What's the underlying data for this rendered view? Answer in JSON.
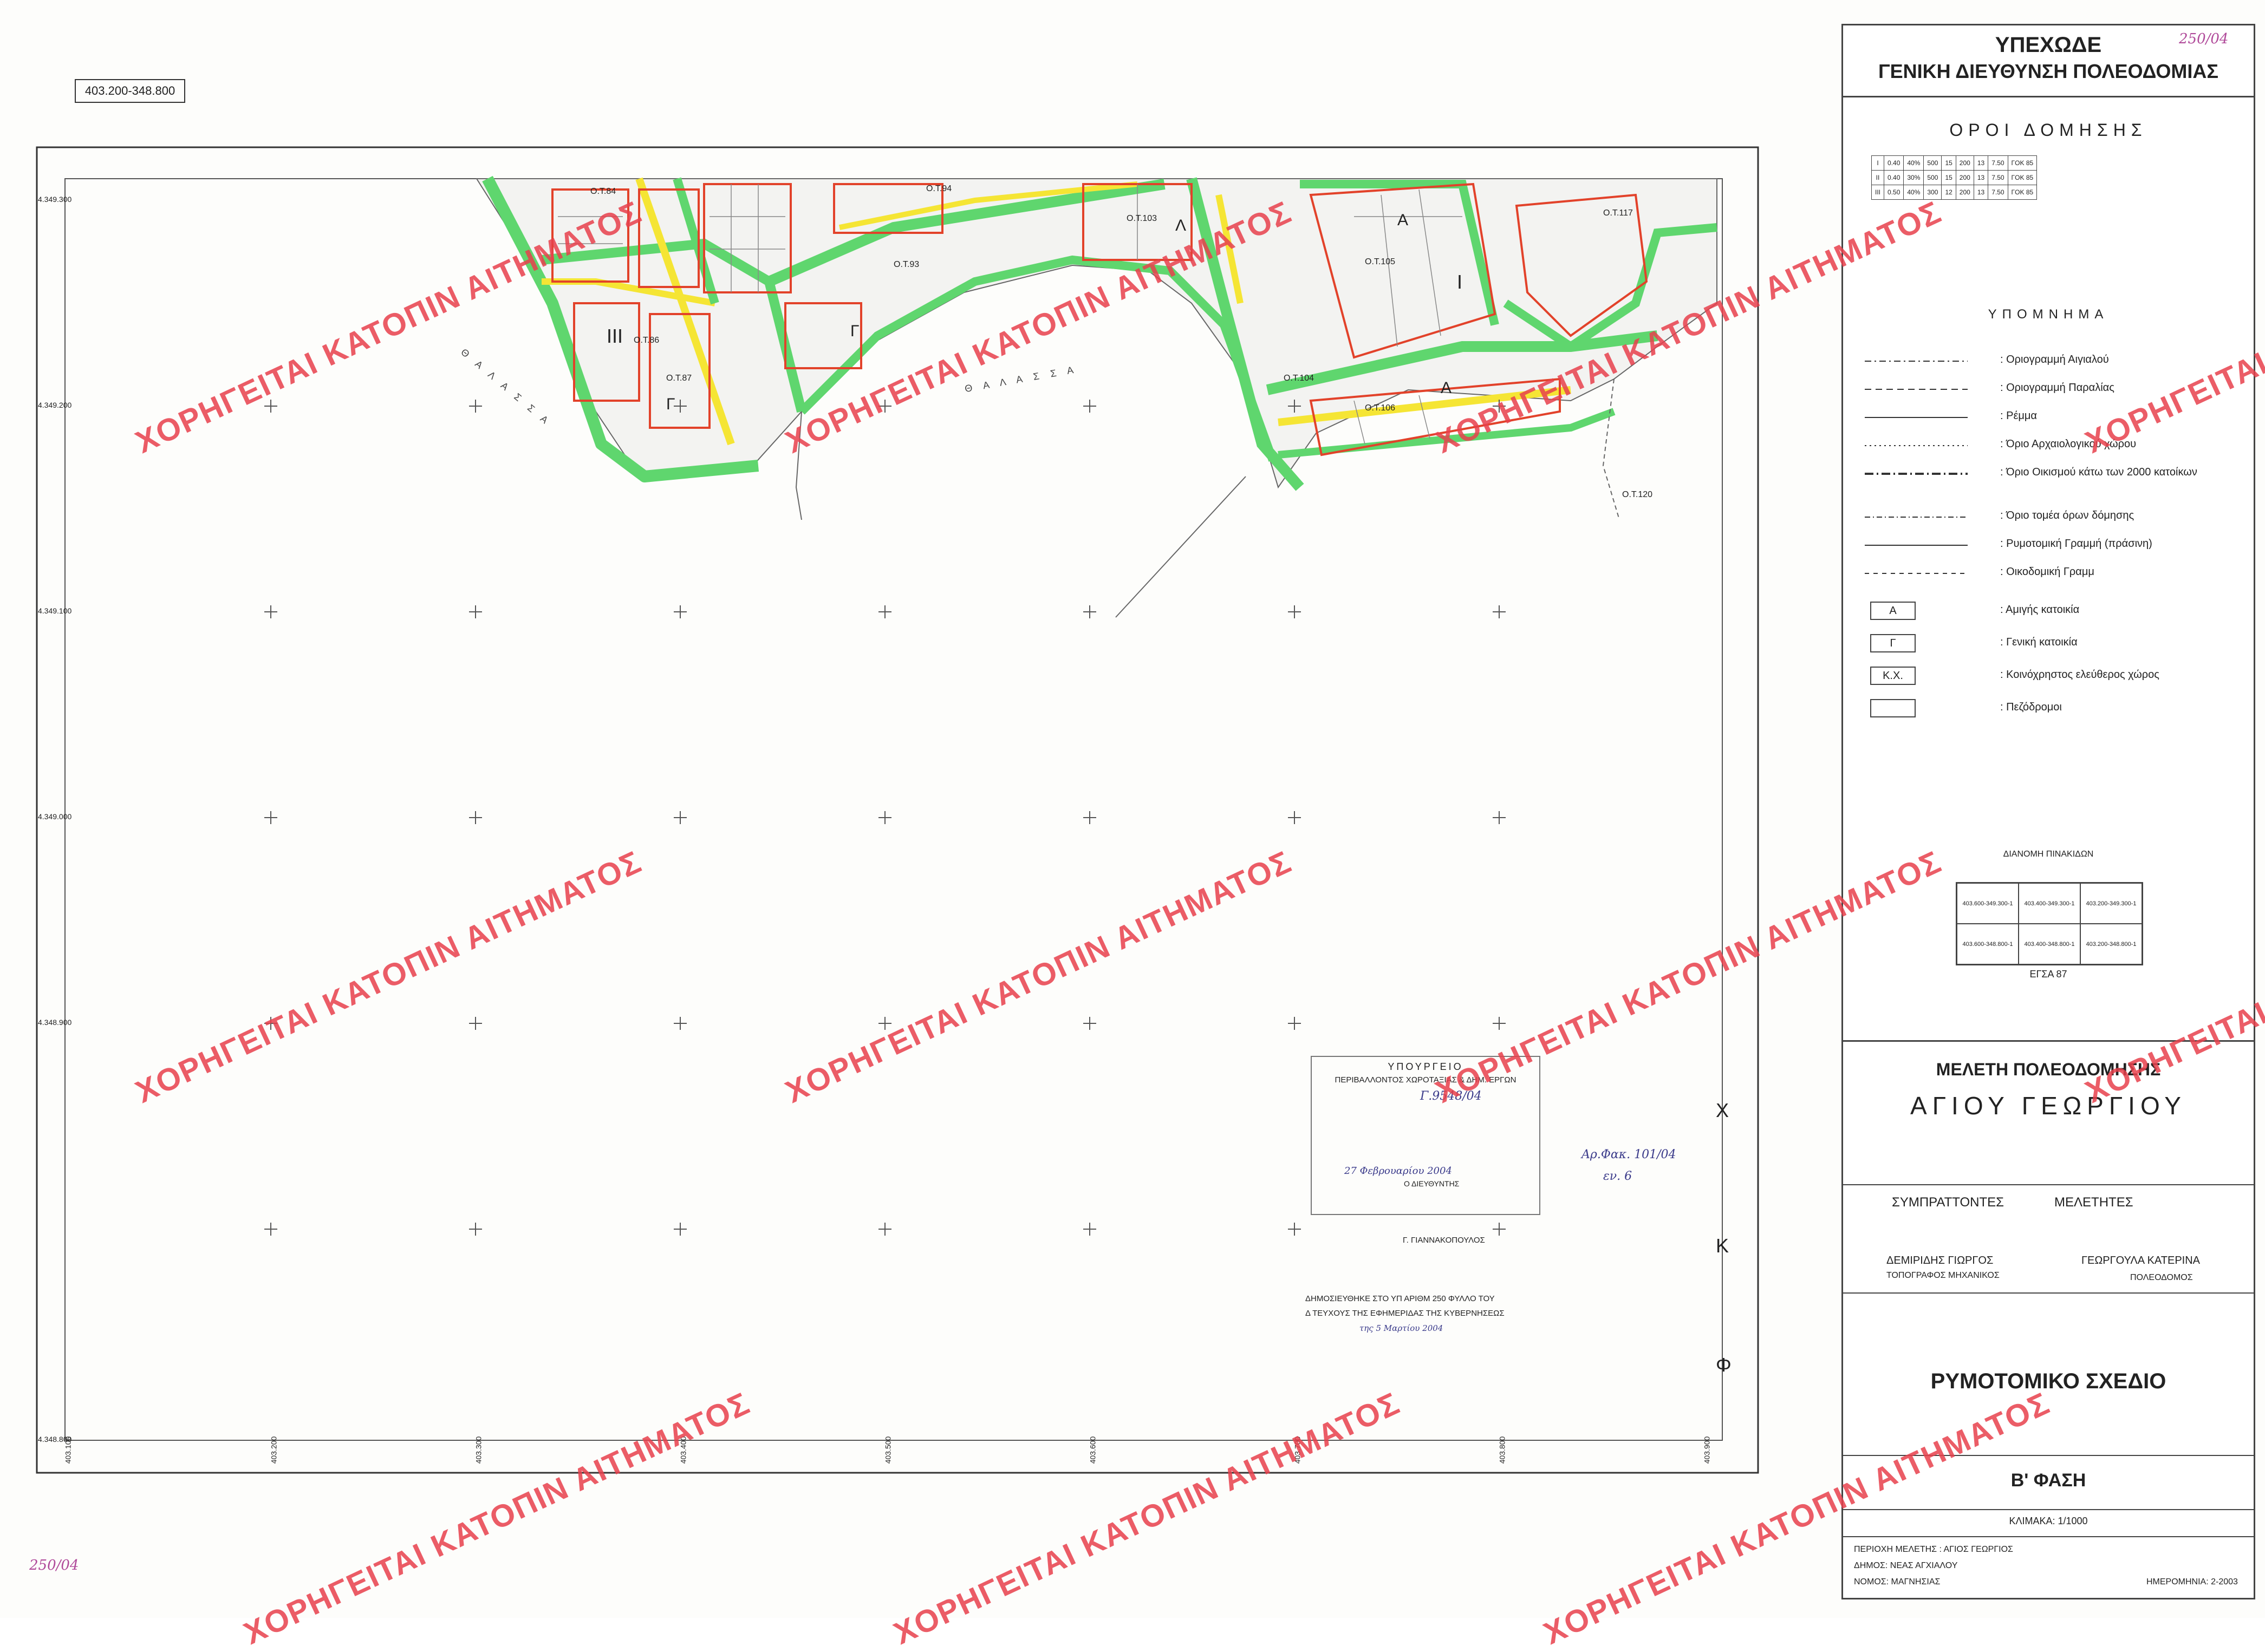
{
  "map_ref": "403.200-348.800",
  "panel": {
    "org_title_1": "ΥΠΕΧΩΔΕ",
    "org_title_2": "ΓΕΝΙΚΗ ΔΙΕΥΘΥΝΣΗ ΠΟΛΕΟΔΟΜΙΑΣ",
    "sheet_number_note": "250/04",
    "building_terms_title": "ΟΡΟΙ ΔΟΜΗΣΗΣ",
    "legend_title": "ΥΠΟΜΝΗΜΑ",
    "legend": [
      {
        "label": ": Οριογραμμή Αιγιαλού",
        "style": "dash-dot"
      },
      {
        "label": ": Οριογραμμή Παραλίας",
        "style": "dash"
      },
      {
        "label": ": Ρέμμα",
        "style": "solid-thin"
      },
      {
        "label": ": Όριο Αρχαιολογικού χώρου",
        "style": "dot"
      },
      {
        "label": ": Όριο Οικισμού κάτω των 2000 κατοίκων",
        "style": "dash-heavy"
      },
      {
        "label": ": Όριο τομέα όρων δόμησης",
        "style": "dash-dot-light"
      },
      {
        "label": ": Ρυμοτομική Γραμμή (πράσινη)",
        "style": "solid"
      },
      {
        "label": ": Οικοδομική Γραμμ",
        "style": "dash-light"
      }
    ],
    "legend_boxes": [
      {
        "code": "Α",
        "label": ": Αμιγής κατοικία"
      },
      {
        "code": "Γ",
        "label": ": Γενική κατοικία"
      },
      {
        "code": "Κ.Χ.",
        "label": ": Κοινόχρηστος ελεύθερος χώρος"
      },
      {
        "code": "",
        "label": ": Πεζόδρομοι"
      }
    ],
    "sheet_index_title": "ΔΙΑΝΟΜΗ ΠΙΝΑΚΙΔΩΝ",
    "sheet_index": [
      "403.600-349.300-1",
      "403.400-349.300-1",
      "403.200-349.300-1",
      "403.600-348.800-1",
      "403.400-348.800-1",
      "403.200-348.800-1"
    ],
    "datum": "ΕΓΣΑ 87",
    "study_title": "ΜΕΛΕΤΗ ΠΟΛΕΟΔΟΜΗΣΗΣ",
    "place_title": "ΑΓΙΟΥ ΓΕΩΡΓΙΟΥ",
    "co_authors_label": "ΣΥΜΠΡΑΤΤΟΝΤΕΣ",
    "authors_label": "ΜΕΛΕΤΗΤΕΣ",
    "author_1_name": "ΔΕΜΙΡΙΔΗΣ ΓΙΩΡΓΟΣ",
    "author_1_role": "ΤΟΠΟΓΡΑΦΟΣ ΜΗΧΑΝΙΚΟΣ",
    "author_2_name": "ΓΕΩΡΓΟΥΛΑ ΚΑΤΕΡΙΝΑ",
    "author_2_role": "ΠΟΛΕΟΔΟΜΟΣ",
    "plan_title": "ΡΥΜΟΤΟΜΙΚΟ ΣΧΕΔΙΟ",
    "phase": "Β' ΦΑΣΗ",
    "scale": "ΚΛΙΜΑΚΑ: 1/1000",
    "area": "ΠΕΡΙΟΧΗ ΜΕΛΕΤΗΣ : ΑΓΙΟΣ ΓΕΩΡΓΙΟΣ",
    "municipality": "ΔΗΜΟΣ: ΝΕΑΣ ΑΓΧΙΑΛΟΥ",
    "prefecture": "ΝΟΜΟΣ: ΜΑΓΝΗΣΙΑΣ",
    "date": "ΗΜΕΡΟΜΗΝΙΑ: 2-2003"
  },
  "terms_table": {
    "rows": [
      [
        "I",
        "0.40",
        "40%",
        "500",
        "15",
        "200",
        "13",
        "7.50",
        "ΓΟΚ 85"
      ],
      [
        "II",
        "0.40",
        "30%",
        "500",
        "15",
        "200",
        "13",
        "7.50",
        "ΓΟΚ 85"
      ],
      [
        "III",
        "0.50",
        "40%",
        "300",
        "12",
        "200",
        "13",
        "7.50",
        "ΓΟΚ 85"
      ]
    ]
  },
  "grid": {
    "x_labels": [
      "403.100",
      "403.200",
      "403.300",
      "403.400",
      "403.500",
      "403.600",
      "403.700",
      "403.800",
      "403.900"
    ],
    "y_labels": [
      "4.349.300",
      "4.349.200",
      "4.349.100",
      "4.349.000",
      "4.348.900",
      "4.348.800"
    ]
  },
  "map_labels": {
    "sea_1": "Θ Α Λ Α Σ Σ Α",
    "sea_2": "Θ Α Λ Α Σ Σ Α",
    "blocks": [
      "Ο.Τ.84",
      "Ο.Τ.86",
      "Ο.Τ.87",
      "Ο.Τ.93",
      "Ο.Τ.94",
      "Ο.Τ.103",
      "Ο.Τ.104",
      "Ο.Τ.105",
      "Ο.Τ.106",
      "Ο.Τ.117",
      "Ο.Τ.120"
    ],
    "zone_labels": [
      "Λ",
      "Γ",
      "Γ",
      "Α",
      "Α",
      "I",
      "III"
    ]
  },
  "stamp": {
    "line1": "ΥΠΟΥΡΓΕΙΟ",
    "line2": "ΠΕΡΙΒΑΛΛΟΝΤΟΣ ΧΩΡΟΤΑΞΙΑΣ & ΔΗΜ. ΕΡΓΩΝ",
    "ref": "Γ.9548/04",
    "sign_date": "27 Φεβρουαρίου 2004",
    "signatory": "Ο ΔΙΕΥΘΥΝΤΗΣ",
    "signatory_name": "Γ. ΓΙΑΝΝΑΚΟΠΟΥΛΟΣ"
  },
  "gazette": {
    "line1": "ΔΗΜΟΣΙΕΥΘΗΚΕ ΣΤΟ ΥΠ ΑΡΙΘΜ 250 ΦΥΛΛΟ ΤΟΥ",
    "line2": "Δ ΤΕΥΧΟΥΣ ΤΗΣ ΕΦΗΜΕΡΙΔΑΣ ΤΗΣ ΚΥΒΕΡΝΗΣΕΩΣ",
    "line3": "της 5 Μαρτίου 2004"
  },
  "hand_notes": {
    "folder": "Αρ.Φακ. 101/04",
    "note2": "εν. 6",
    "corner": "250/04"
  },
  "side_letters": [
    "Χ",
    "Κ",
    "Φ"
  ],
  "watermark": "ΧΟΡΗΓΕΙΤΑΙ ΚΑΤΟΠΙΝ ΑΙΤΗΜΑΤΟΣ",
  "colors": {
    "road_green": "#4fd26a",
    "road_yellow": "#f7e93a",
    "building_line_red": "#e2422a",
    "watermark_red": "#e8414d"
  }
}
